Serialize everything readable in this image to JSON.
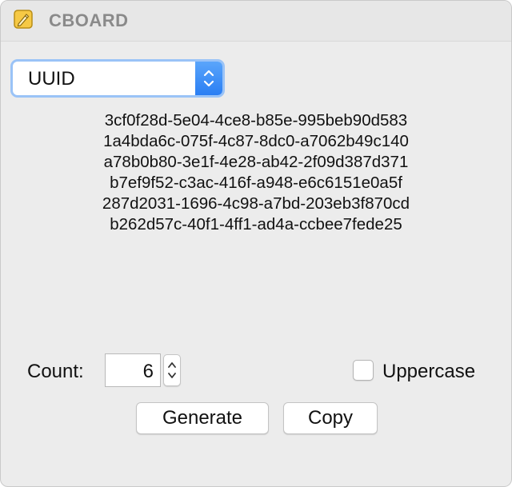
{
  "window": {
    "title": "CBOARD",
    "app_icon": "pencil-note-icon"
  },
  "generator": {
    "type_selected": "UUID"
  },
  "output": {
    "lines": [
      "3cf0f28d-5e04-4ce8-b85e-995beb90d583",
      "1a4bda6c-075f-4c87-8dc0-a7062b49c140",
      "a78b0b80-3e1f-4e28-ab42-2f09d387d371",
      "b7ef9f52-c3ac-416f-a948-e6c6151e0a5f",
      "287d2031-1696-4c98-a7bd-203eb3f870cd",
      "b262d57c-40f1-4ff1-ad4a-ccbee7fede25"
    ]
  },
  "controls": {
    "count_label": "Count:",
    "count_value": "6",
    "uppercase_label": "Uppercase",
    "uppercase_checked": false,
    "generate_label": "Generate",
    "copy_label": "Copy"
  },
  "colors": {
    "accent": "#2a7ef3",
    "focus_ring": "#9ac3f7",
    "window_bg": "#ececec",
    "icon_yellow": "#f6c945"
  }
}
